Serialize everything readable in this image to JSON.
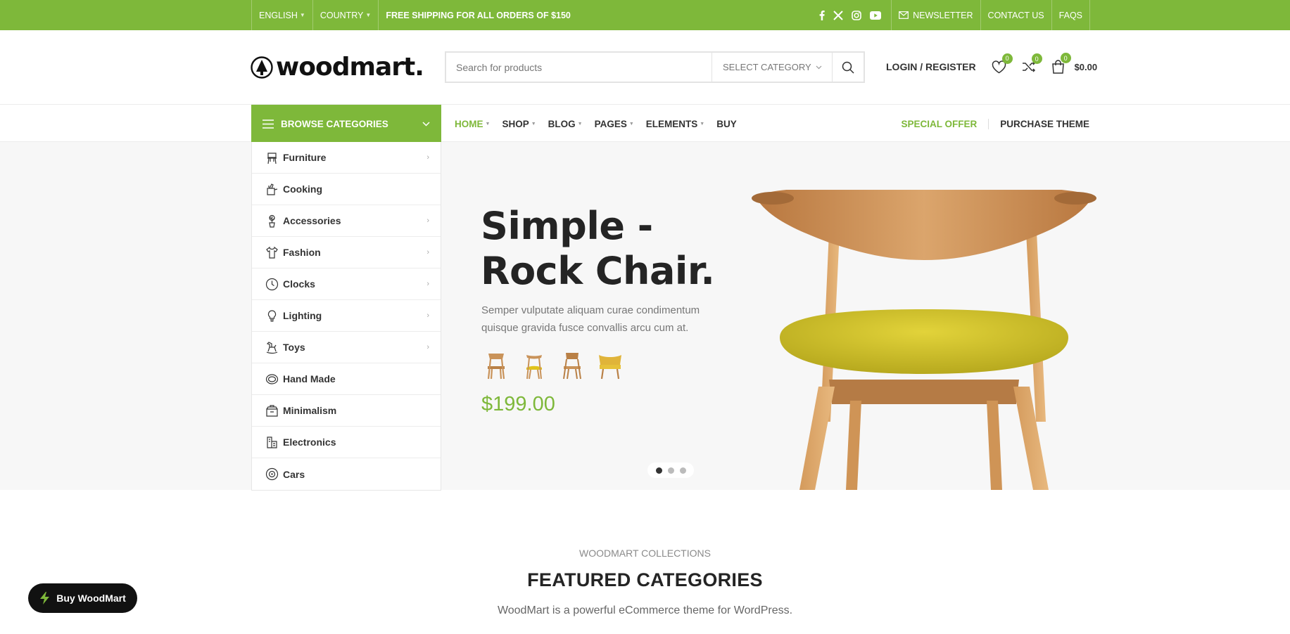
{
  "topbar": {
    "language": "ENGLISH",
    "country": "COUNTRY",
    "shipping": "FREE SHIPPING FOR ALL ORDERS OF $150",
    "social_icons": [
      "facebook-icon",
      "x-icon",
      "instagram-icon",
      "youtube-icon"
    ],
    "newsletter": "NEWSLETTER",
    "contact": "CONTACT US",
    "faqs": "FAQS"
  },
  "header": {
    "logo_text": "woodmart.",
    "search_placeholder": "Search for products",
    "select_category": "SELECT CATEGORY",
    "login": "LOGIN / REGISTER",
    "wishlist_count": "0",
    "compare_count": "0",
    "cart_count": "0",
    "cart_total": "$0.00"
  },
  "nav": {
    "browse": "BROWSE CATEGORIES",
    "items": [
      {
        "label": "HOME"
      },
      {
        "label": "SHOP"
      },
      {
        "label": "BLOG"
      },
      {
        "label": "PAGES"
      },
      {
        "label": "ELEMENTS"
      },
      {
        "label": "BUY"
      }
    ],
    "special_offer": "SPECIAL OFFER",
    "purchase_theme": "PURCHASE THEME"
  },
  "categories": [
    {
      "label": "Furniture",
      "icon": "chair-icon"
    },
    {
      "label": "Cooking",
      "icon": "cooking-icon"
    },
    {
      "label": "Accessories",
      "icon": "cactus-icon"
    },
    {
      "label": "Fashion",
      "icon": "shirt-icon"
    },
    {
      "label": "Clocks",
      "icon": "clock-icon"
    },
    {
      "label": "Lighting",
      "icon": "bulb-icon"
    },
    {
      "label": "Toys",
      "icon": "rocking-horse-icon"
    },
    {
      "label": "Hand Made",
      "icon": "yarn-icon"
    },
    {
      "label": "Minimalism",
      "icon": "box-icon"
    },
    {
      "label": "Electronics",
      "icon": "electronics-icon"
    },
    {
      "label": "Cars",
      "icon": "wheel-icon"
    }
  ],
  "hero": {
    "title_line1": "Simple -",
    "title_line2": "Rock Chair.",
    "description": "Semper vulputate aliquam curae condimentum quisque gravida fusce convallis arcu cum at.",
    "price": "$199.00",
    "slides_total": 3,
    "active_slide": 1
  },
  "featured": {
    "subtitle": "WOODMART COLLECTIONS",
    "title": "FEATURED CATEGORIES",
    "description": "WoodMart is a powerful eCommerce theme for WordPress."
  },
  "buy_button": "Buy WoodMart",
  "colors": {
    "accent": "#7eb83a",
    "dark": "#242424"
  }
}
